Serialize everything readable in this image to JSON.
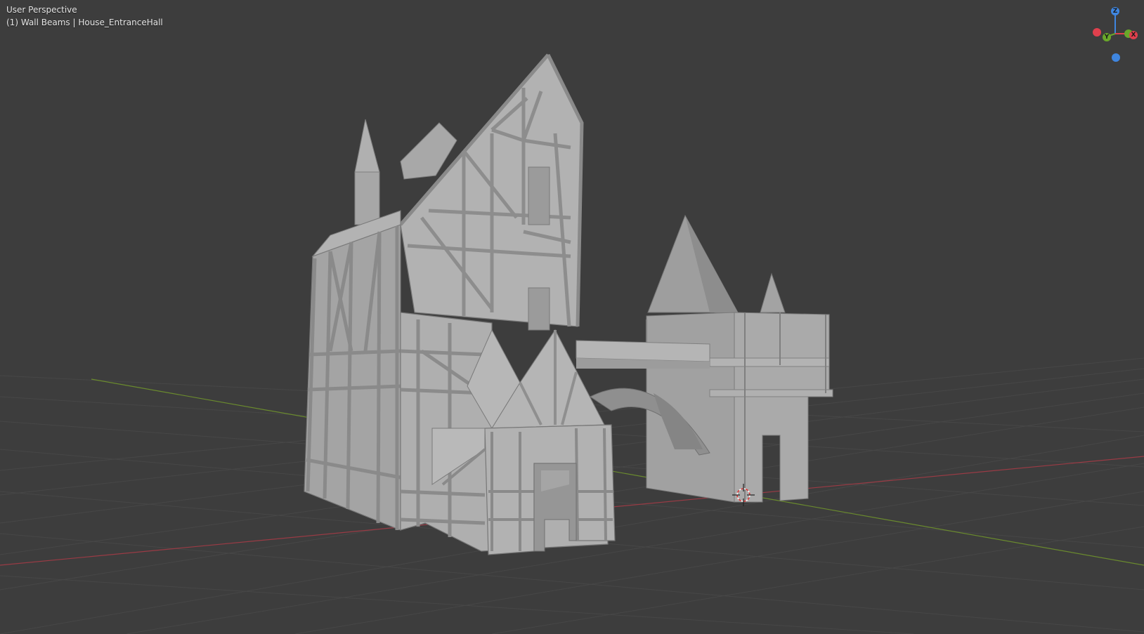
{
  "viewport": {
    "view_name": "User Perspective",
    "object_info": "(1) Wall Beams | House_EntranceHall",
    "colors": {
      "background": "#3d3d3d",
      "grid": "#4a4a4a",
      "x_axis": "#9a3b45",
      "y_axis": "#6a8a2e",
      "model_light": "#a8a8a8",
      "model_mid": "#979797",
      "model_dark": "#7f7f7f"
    }
  },
  "gizmo": {
    "z_label": "Z",
    "y_label": "Y",
    "x_label": "X",
    "colors": {
      "x": "#e0404d",
      "y": "#6aa82a",
      "z": "#3f86e0"
    }
  },
  "scene": {
    "object_name": "House_EntranceHall",
    "active_element": "Wall Beams",
    "cursor": "3d-cursor"
  }
}
